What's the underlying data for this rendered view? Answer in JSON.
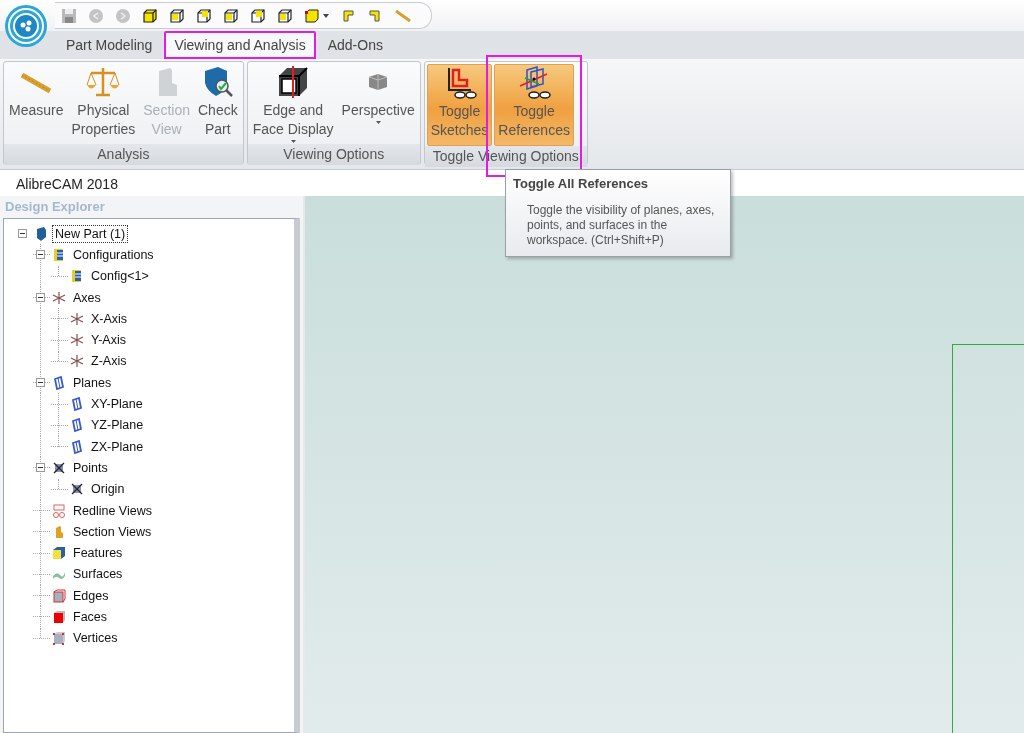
{
  "tabs": [
    {
      "label": "Part Modeling",
      "selected": false,
      "highlighted": false
    },
    {
      "label": "Viewing and Analysis",
      "selected": true,
      "highlighted": true
    },
    {
      "label": "Add-Ons",
      "selected": false,
      "highlighted": false
    }
  ],
  "ribbon_groups": [
    {
      "label": "Analysis",
      "buttons": [
        {
          "kind": "ruler",
          "lines": [
            "Measure"
          ],
          "disabled": false,
          "active": false,
          "has_menu": false,
          "highlighted": false
        },
        {
          "kind": "scale",
          "lines": [
            "Physical",
            "Properties"
          ],
          "disabled": false,
          "active": false,
          "has_menu": false,
          "highlighted": false
        },
        {
          "kind": "section",
          "lines": [
            "Section",
            "View"
          ],
          "disabled": true,
          "active": false,
          "has_menu": false,
          "highlighted": false
        },
        {
          "kind": "check",
          "lines": [
            "Check",
            "Part"
          ],
          "disabled": false,
          "active": false,
          "has_menu": false,
          "highlighted": false
        }
      ]
    },
    {
      "label": "Viewing Options",
      "buttons": [
        {
          "kind": "edges",
          "lines": [
            "Edge and",
            "Face Display"
          ],
          "disabled": false,
          "active": false,
          "has_menu": true,
          "highlighted": false
        },
        {
          "kind": "perspective",
          "lines": [
            "Perspective"
          ],
          "disabled": false,
          "active": false,
          "has_menu": true,
          "highlighted": false
        }
      ]
    },
    {
      "label": "Toggle Viewing Options",
      "buttons": [
        {
          "kind": "sketches",
          "lines": [
            "Toggle",
            "Sketches"
          ],
          "disabled": false,
          "active": true,
          "has_menu": false,
          "highlighted": false
        },
        {
          "kind": "references",
          "lines": [
            "Toggle",
            "References"
          ],
          "disabled": false,
          "active": true,
          "has_menu": false,
          "highlighted": true
        }
      ]
    }
  ],
  "tooltip": {
    "title": "Toggle All References",
    "text": "Toggle the visibility of planes, axes, points, and surfaces in the workspace. (Ctrl+Shift+P)"
  },
  "document_title": "AlibreCAM 2018",
  "explorer": {
    "title": "Design Explorer",
    "tree": [
      {
        "label": "New Part (1)",
        "kind": "part",
        "selected": true,
        "expanded": true,
        "children": [
          {
            "label": "Configurations",
            "kind": "config",
            "selected": false,
            "expanded": true,
            "children": [
              {
                "label": "Config<1>",
                "kind": "config",
                "selected": false
              }
            ]
          },
          {
            "label": "Axes",
            "kind": "axis",
            "selected": false,
            "expanded": true,
            "children": [
              {
                "label": "X-Axis",
                "kind": "axis",
                "selected": false
              },
              {
                "label": "Y-Axis",
                "kind": "axis",
                "selected": false
              },
              {
                "label": "Z-Axis",
                "kind": "axis",
                "selected": false
              }
            ]
          },
          {
            "label": "Planes",
            "kind": "plane",
            "selected": false,
            "expanded": true,
            "children": [
              {
                "label": "XY-Plane",
                "kind": "plane",
                "selected": false
              },
              {
                "label": "YZ-Plane",
                "kind": "plane",
                "selected": false
              },
              {
                "label": "ZX-Plane",
                "kind": "plane",
                "selected": false
              }
            ]
          },
          {
            "label": "Points",
            "kind": "point",
            "selected": false,
            "expanded": true,
            "children": [
              {
                "label": "Origin",
                "kind": "point",
                "selected": false
              }
            ]
          },
          {
            "label": "Redline Views",
            "kind": "redline",
            "selected": false
          },
          {
            "label": "Section Views",
            "kind": "section",
            "selected": false
          },
          {
            "label": "Features",
            "kind": "feature",
            "selected": false
          },
          {
            "label": "Surfaces",
            "kind": "surface",
            "selected": false
          },
          {
            "label": "Edges",
            "kind": "edge",
            "selected": false
          },
          {
            "label": "Faces",
            "kind": "face",
            "selected": false
          },
          {
            "label": "Vertices",
            "kind": "vertex",
            "selected": false
          }
        ]
      }
    ]
  }
}
